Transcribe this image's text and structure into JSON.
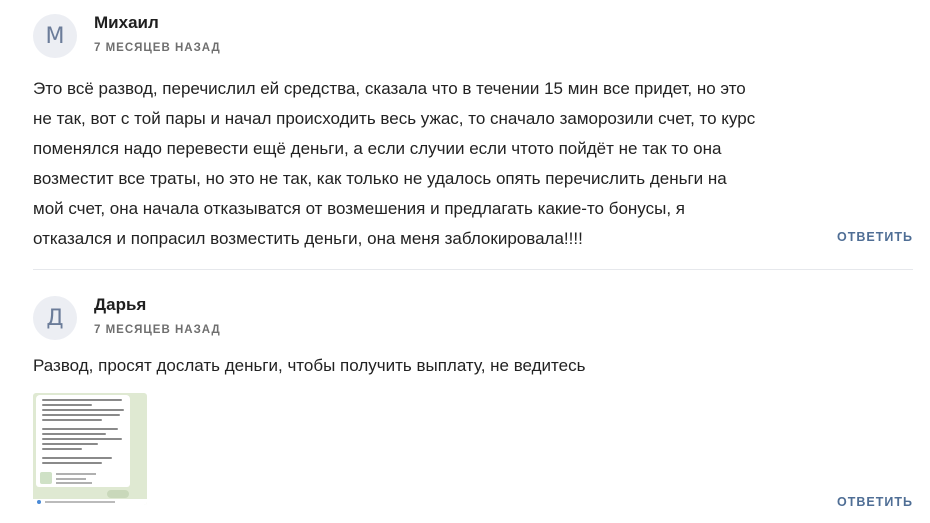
{
  "comments": [
    {
      "avatar_letter": "М",
      "author": "Михаил",
      "time": "7 МЕСЯЦЕВ НАЗАД",
      "lines": [
        "Это всё развод, перечислил ей средства, сказала что в течении 15 мин все придет, но это",
        "не так, вот с той пары и начал происходить весь ужас, то сначало заморозили счет, то курс",
        "поменялся надо перевести ещё деньги, а если случии если чтото пойдёт не так то она",
        "возместит все траты, но это не так, как только не удалось опять перечислить деньги на",
        "мой счет, она начала отказыватся от возмешения и предлагать какие-то бонусы, я",
        "отказался и попрасил возместить деньги, она меня заблокировала!!!!"
      ],
      "reply_label": "ОТВЕТИТЬ"
    },
    {
      "avatar_letter": "Д",
      "author": "Дарья",
      "time": "7 МЕСЯЦЕВ НАЗАД",
      "lines": [
        "Развод, просят дослать деньги, чтобы получить выплату, не ведитесь"
      ],
      "attachment": "screenshot-thumbnail",
      "reply_label": "ОТВЕТИТЬ"
    }
  ],
  "colors": {
    "author": "#1f1f1f",
    "meta": "#6f6f6f",
    "reply": "#4f6e95",
    "avatar_bg": "#eceef3",
    "avatar_fg": "#6b7c99",
    "divider": "#e6e8ec"
  }
}
